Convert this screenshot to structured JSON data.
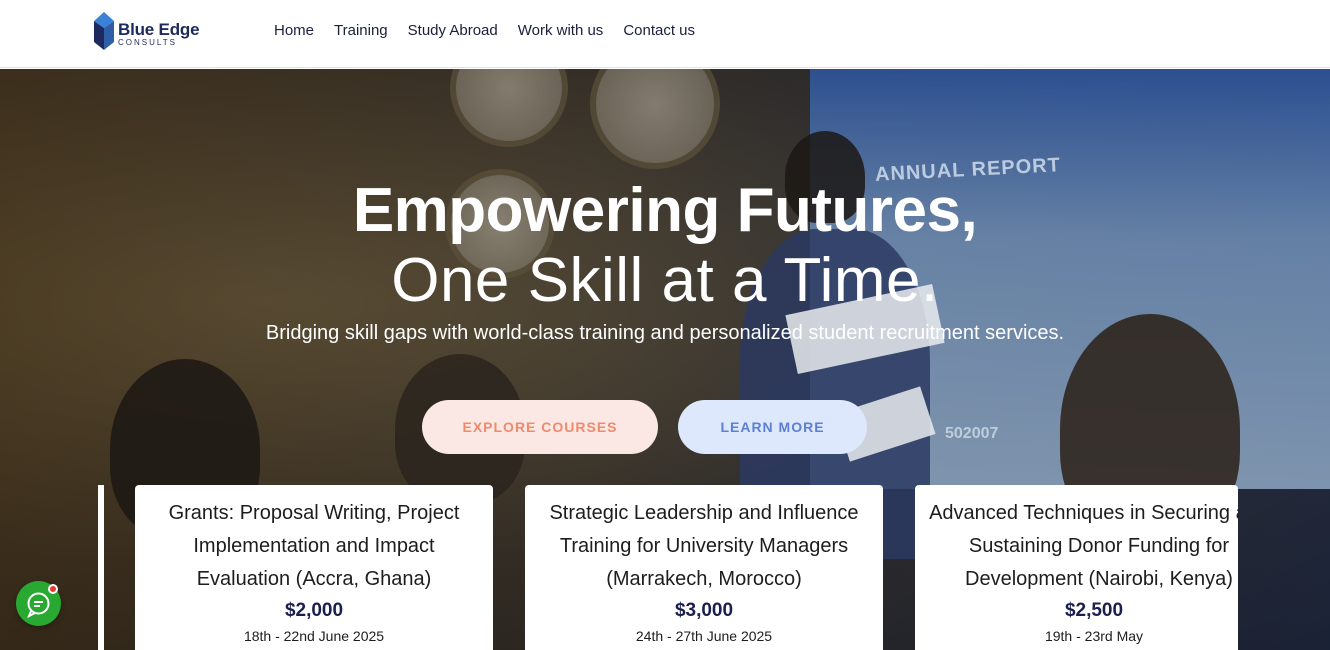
{
  "brand": {
    "name": "Blue Edge",
    "sub": "CONSULTS"
  },
  "nav": {
    "items": [
      "Home",
      "Training",
      "Study Abroad",
      "Work with us",
      "Contact us"
    ]
  },
  "hero": {
    "title_line1": "Empowering Futures,",
    "title_line2": "One Skill at a Time.",
    "subtitle": "Bridging skill gaps with world-class training and personalized student recruitment services.",
    "explore_label": "EXPLORE COURSES",
    "learn_label": "LEARN MORE",
    "bg_screen_title": "ANNUAL REPORT",
    "bg_screen_number": "502007"
  },
  "courses": [
    {
      "title": "Grants: Proposal Writing, Project Implementation and Impact Evaluation (Accra, Ghana)",
      "price": "$2,000",
      "date": "18th - 22nd June 2025"
    },
    {
      "title": "Strategic Leadership and Influence Training for University Managers (Marrakech, Morocco)",
      "price": "$3,000",
      "date": "24th - 27th June 2025"
    },
    {
      "title": "Advanced Techniques in Securing and Sustaining Donor Funding for Development (Nairobi, Kenya)",
      "price": "$2,500",
      "date": "19th - 23rd May"
    }
  ],
  "colors": {
    "brand_navy": "#1e2a5e",
    "explore_bg": "#fbe8e4",
    "explore_text": "#f08a6c",
    "learn_bg": "#dde8fc",
    "learn_text": "#5d7fd6",
    "chat_green": "#29a832"
  },
  "icons": {
    "chat": "chat-bubble-icon",
    "logo": "blue-edge-logo-icon"
  }
}
